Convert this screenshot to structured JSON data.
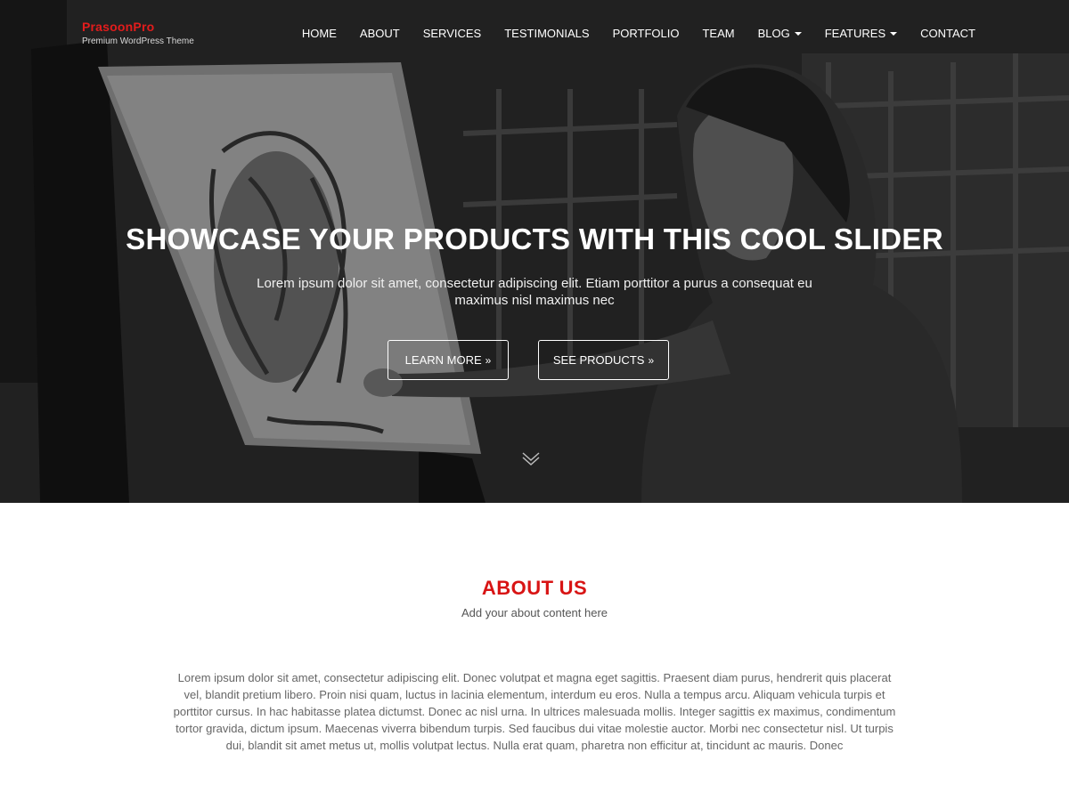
{
  "brand": {
    "name": "PrasoonPro",
    "tagline": "Premium WordPress Theme"
  },
  "nav": {
    "items": [
      {
        "label": "HOME",
        "dropdown": false
      },
      {
        "label": "ABOUT",
        "dropdown": false
      },
      {
        "label": "SERVICES",
        "dropdown": false
      },
      {
        "label": "TESTIMONIALS",
        "dropdown": false
      },
      {
        "label": "PORTFOLIO",
        "dropdown": false
      },
      {
        "label": "TEAM",
        "dropdown": false
      },
      {
        "label": "BLOG",
        "dropdown": true
      },
      {
        "label": "FEATURES",
        "dropdown": true
      },
      {
        "label": "CONTACT",
        "dropdown": false
      }
    ]
  },
  "hero": {
    "title": "SHOWCASE YOUR PRODUCTS WITH THIS COOL SLIDER",
    "subtitle": "Lorem ipsum dolor sit amet, consectetur adipiscing elit. Etiam porttitor a purus a consequat eu maximus nisl maximus nec",
    "buttons": {
      "learn_more": "LEARN MORE",
      "see_products": "SEE PRODUCTS"
    },
    "button_icon": "double-chevron-right-icon",
    "scroll_icon": "chevron-down-icon"
  },
  "about": {
    "title_bold": "ABOUT",
    "title_light": "US",
    "subtitle": "Add your about content here",
    "body": "Lorem ipsum dolor sit amet, consectetur adipiscing elit. Donec volutpat et magna eget sagittis. Praesent diam purus, hendrerit quis placerat vel, blandit pretium libero. Proin nisi quam, luctus in lacinia elementum, interdum eu eros. Nulla a tempus arcu. Aliquam vehicula turpis et porttitor cursus. In hac habitasse platea dictumst. Donec ac nisl urna. In ultrices malesuada mollis. Integer sagittis ex maximus, condimentum tortor gravida, dictum ipsum. Maecenas viverra bibendum turpis. Sed faucibus dui vitae molestie auctor. Morbi nec consectetur nisl. Ut turpis dui, blandit sit amet metus ut, mollis volutpat lectus. Nulla erat quam, pharetra non efficitur at, tincidunt ac mauris. Donec"
  },
  "colors": {
    "accent": "#d81414",
    "hero_text": "#ffffff",
    "body_text": "#666666"
  }
}
